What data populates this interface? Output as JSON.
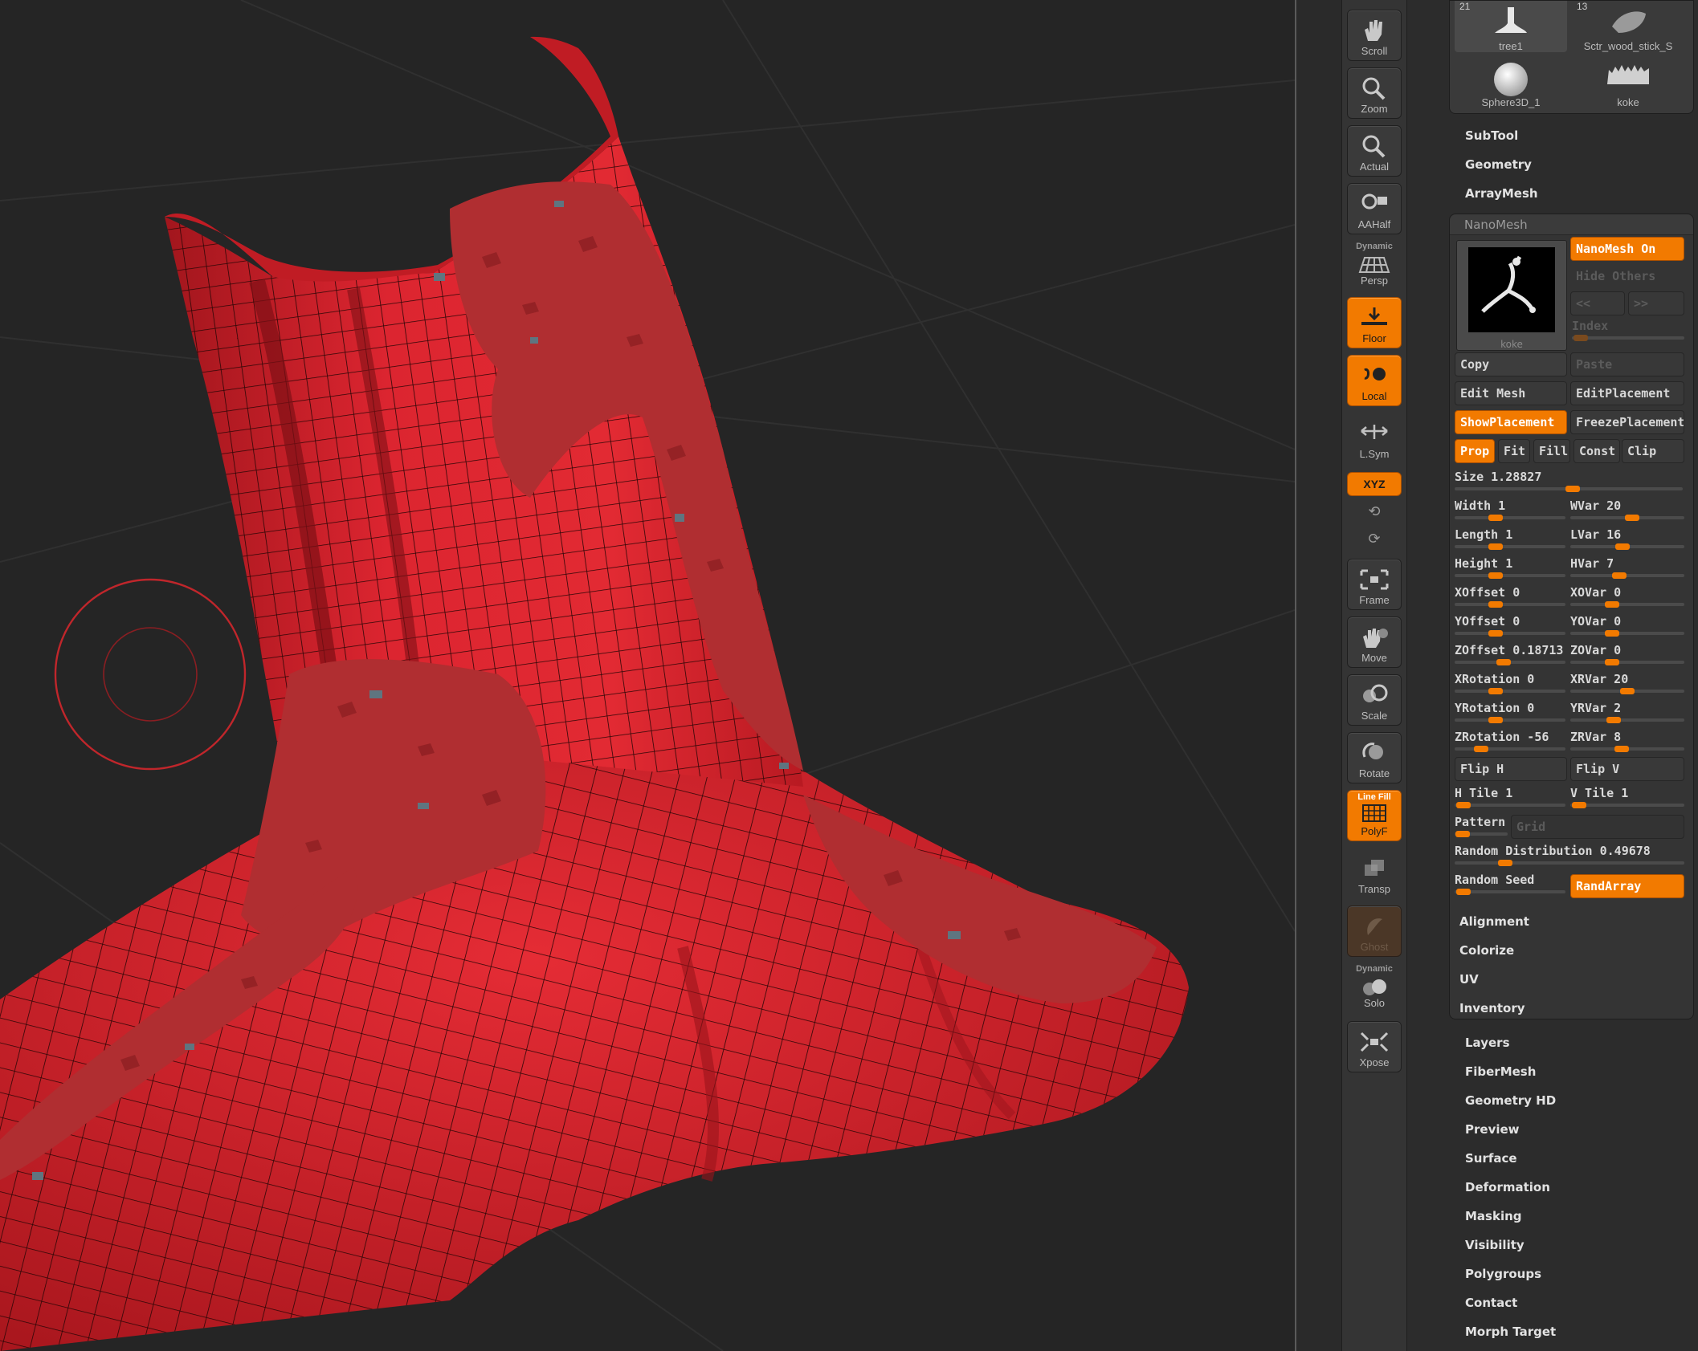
{
  "shelf": {
    "buttons": [
      {
        "id": "scroll",
        "label": "Scroll",
        "active": false
      },
      {
        "id": "zoom",
        "label": "Zoom",
        "active": false
      },
      {
        "id": "actual",
        "label": "Actual",
        "active": false
      },
      {
        "id": "aahalf",
        "label": "AAHalf",
        "active": false
      },
      {
        "id": "persp",
        "label": "Persp",
        "tag": "Dynamic",
        "active": false
      },
      {
        "id": "floor",
        "label": "Floor",
        "active": true
      },
      {
        "id": "local",
        "label": "Local",
        "active": true
      },
      {
        "id": "lsym",
        "label": "L.Sym",
        "active": false
      },
      {
        "id": "frame",
        "label": "Frame",
        "active": false
      },
      {
        "id": "move",
        "label": "Move",
        "active": false
      },
      {
        "id": "scale",
        "label": "Scale",
        "active": false
      },
      {
        "id": "rotate",
        "label": "Rotate",
        "active": false
      },
      {
        "id": "polyf",
        "label": "PolyF",
        "tag": "Line Fill",
        "active": true
      },
      {
        "id": "transp",
        "label": "Transp",
        "active": false
      },
      {
        "id": "ghost",
        "label": "Ghost",
        "active": false
      },
      {
        "id": "solo",
        "label": "Solo",
        "tag": "Dynamic",
        "active": false
      },
      {
        "id": "xpose",
        "label": "Xpose",
        "active": false
      }
    ],
    "xyz_label": "XYZ"
  },
  "tools": [
    {
      "count": "21",
      "name": "tree1"
    },
    {
      "count": "13",
      "name": "Sctr_wood_stick_S"
    },
    {
      "count": "",
      "name": "Sphere3D_1"
    },
    {
      "count": "",
      "name": "koke"
    }
  ],
  "menus_top": [
    "SubTool",
    "Geometry",
    "ArrayMesh"
  ],
  "nanomesh": {
    "header": "NanoMesh",
    "preview_name": "koke",
    "nanomesh_on": "NanoMesh On",
    "hide_others": "Hide Others",
    "prev": "<<",
    "next": ">>",
    "index_label": "Index",
    "copy": "Copy",
    "paste": "Paste",
    "edit_mesh": "Edit Mesh",
    "edit_placement": "EditPlacement",
    "show_placement": "ShowPlacement",
    "freeze_placement": "FreezePlacement",
    "prop": "Prop",
    "fit": "Fit",
    "fill": "Fill",
    "const": "Const",
    "clip": "Clip",
    "size": {
      "label": "Size 1.28827",
      "value": 0.52
    },
    "sliders": [
      [
        {
          "label": "Width 1",
          "value": 0.35
        },
        {
          "label": "WVar 20",
          "value": 0.55
        }
      ],
      [
        {
          "label": "Length 1",
          "value": 0.35
        },
        {
          "label": "LVar 16",
          "value": 0.45
        }
      ],
      [
        {
          "label": "Height 1",
          "value": 0.35
        },
        {
          "label": "HVar 7",
          "value": 0.42
        }
      ],
      [
        {
          "label": "XOffset 0",
          "value": 0.35
        },
        {
          "label": "XOVar 0",
          "value": 0.35
        }
      ],
      [
        {
          "label": "YOffset 0",
          "value": 0.35
        },
        {
          "label": "YOVar 0",
          "value": 0.35
        }
      ],
      [
        {
          "label": "ZOffset 0.18713",
          "value": 0.43
        },
        {
          "label": "ZOVar 0",
          "value": 0.35
        }
      ],
      [
        {
          "label": "XRotation 0",
          "value": 0.35
        },
        {
          "label": "XRVar 20",
          "value": 0.5
        }
      ],
      [
        {
          "label": "YRotation 0",
          "value": 0.35
        },
        {
          "label": "YRVar 2",
          "value": 0.36
        }
      ],
      [
        {
          "label": "ZRotation -56",
          "value": 0.2
        },
        {
          "label": "ZRVar 8",
          "value": 0.44
        }
      ]
    ],
    "flip_h": "Flip H",
    "flip_v": "Flip V",
    "h_tile": {
      "label": "H Tile 1",
      "value": 0.02
    },
    "v_tile": {
      "label": "V Tile 1",
      "value": 0.02
    },
    "pattern": {
      "label": "Pattern",
      "value": 0.02
    },
    "grid": "Grid",
    "random_distribution": {
      "label": "Random Distribution 0.49678",
      "value": 0.2
    },
    "random_seed": {
      "label": "Random Seed",
      "value": 0.02
    },
    "randarray": "RandArray",
    "submenus": [
      "Alignment",
      "Colorize",
      "UV",
      "Inventory"
    ]
  },
  "menus_bottom": [
    "Layers",
    "FiberMesh",
    "Geometry HD",
    "Preview",
    "Surface",
    "Deformation",
    "Masking",
    "Visibility",
    "Polygroups",
    "Contact",
    "Morph Target"
  ],
  "colors": {
    "accent": "#f27a00",
    "mesh": "#d8222b",
    "nano": "#b53032",
    "bg": "#252525"
  }
}
